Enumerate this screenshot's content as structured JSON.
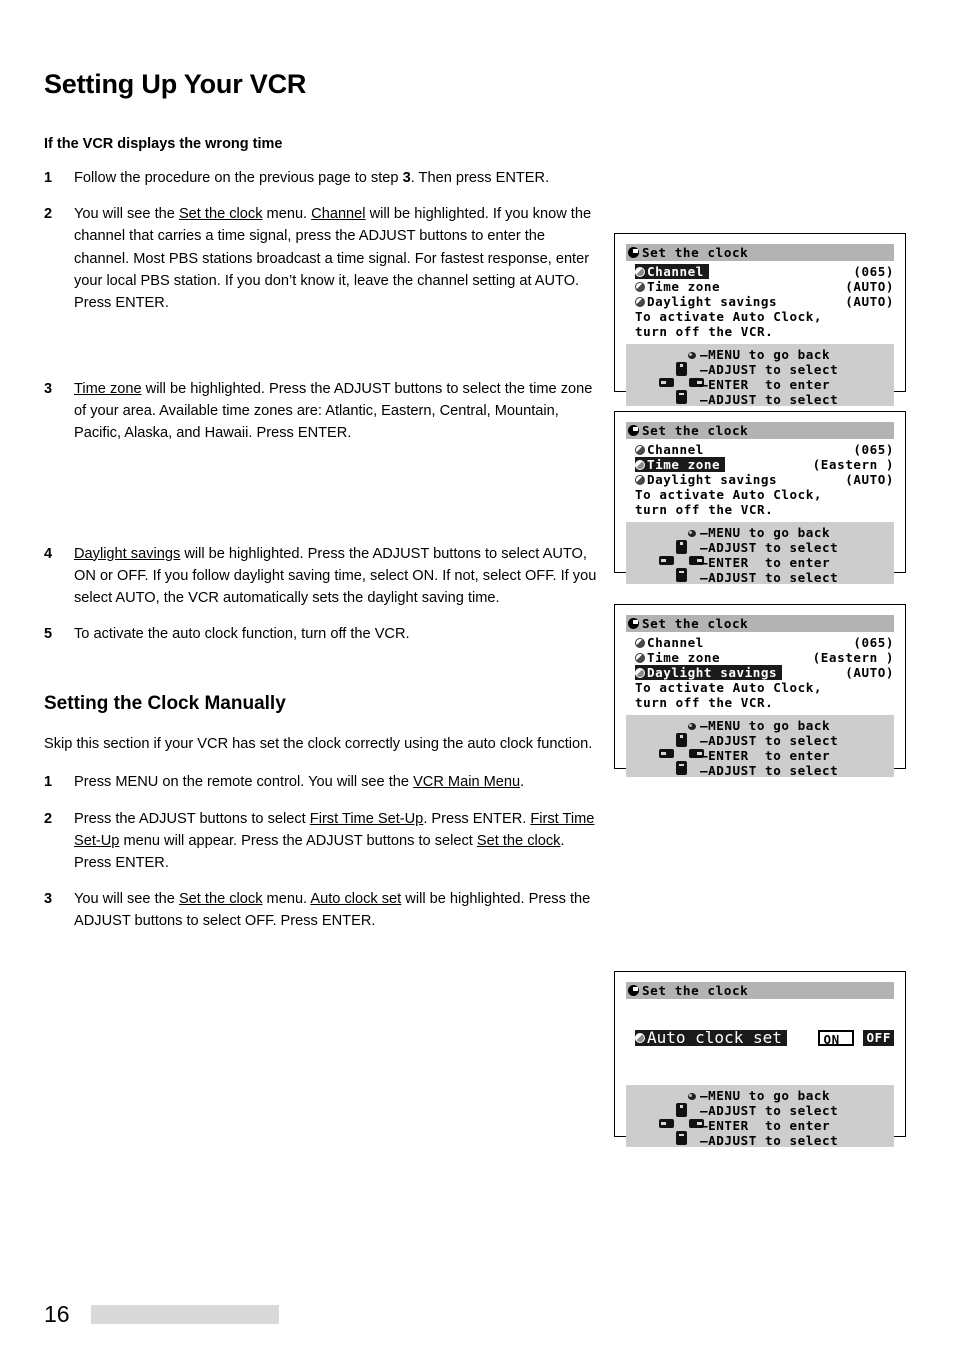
{
  "document": {
    "title": "Setting Up Your VCR",
    "folio": "16"
  },
  "section_wrong_time": {
    "heading": "If the VCR displays the wrong time",
    "steps": [
      {
        "num": "1",
        "parts": [
          {
            "t": "Follow the procedure on the previous page to step ",
            "style": "plain"
          },
          {
            "t": "3",
            "style": "bold"
          },
          {
            "t": ".  Then press ENTER.",
            "style": "plain"
          }
        ]
      },
      {
        "num": "2",
        "parts": [
          {
            "t": "You will see the ",
            "style": "plain"
          },
          {
            "t": "Set the clock",
            "style": "underline"
          },
          {
            "t": " menu.  ",
            "style": "plain"
          },
          {
            "t": "Channel",
            "style": "underline"
          },
          {
            "t": " will be highlighted.  If you know the channel that carries a time signal, press the ADJUST buttons to enter the channel.  Most PBS stations broadcast a time signal.  For fastest response, enter your local PBS station.  If you don’t know it, leave the channel setting at AUTO.  Press ENTER.",
            "style": "plain"
          }
        ]
      },
      {
        "num": "3",
        "parts": [
          {
            "t": "Time zone",
            "style": "underline"
          },
          {
            "t": " will be highlighted.  Press the ADJUST buttons to select the time zone of your area.  Available time zones are: Atlantic, Eastern, Central, Mountain, Pacific, Alaska, and Hawaii.  Press ENTER.",
            "style": "plain"
          }
        ]
      },
      {
        "num": "4",
        "parts": [
          {
            "t": "Daylight savings",
            "style": "underline"
          },
          {
            "t": " will be highlighted.  Press the ADJUST buttons to select AUTO, ON or OFF.  If you follow daylight saving time, select ON.  If not, select OFF.  If you select AUTO, the VCR automatically sets the daylight saving time.",
            "style": "plain"
          }
        ]
      },
      {
        "num": "5",
        "parts": [
          {
            "t": "To activate the auto clock function, turn off the VCR.",
            "style": "plain"
          }
        ]
      }
    ]
  },
  "section_manual": {
    "heading": "Setting the Clock Manually",
    "intro": "Skip this section if your VCR has set the clock correctly using the auto clock function.",
    "steps": [
      {
        "num": "1",
        "parts": [
          {
            "t": "Press MENU on the remote control.  You will see the ",
            "style": "plain"
          },
          {
            "t": "VCR Main Menu",
            "style": "underline"
          },
          {
            "t": ".",
            "style": "plain"
          }
        ]
      },
      {
        "num": "2",
        "parts": [
          {
            "t": "Press the ADJUST buttons to select ",
            "style": "plain"
          },
          {
            "t": "First Time Set-Up",
            "style": "underline"
          },
          {
            "t": ".  Press ENTER.  ",
            "style": "plain"
          },
          {
            "t": "First Time Set-Up",
            "style": "underline"
          },
          {
            "t": " menu will appear.  Press the ADJUST buttons to select ",
            "style": "plain"
          },
          {
            "t": "Set the clock",
            "style": "underline"
          },
          {
            "t": ".  Press ENTER.",
            "style": "plain"
          }
        ]
      },
      {
        "num": "3",
        "parts": [
          {
            "t": "You will see the ",
            "style": "plain"
          },
          {
            "t": "Set the clock",
            "style": "underline"
          },
          {
            "t": " menu.  ",
            "style": "plain"
          },
          {
            "t": "Auto clock set",
            "style": "underline"
          },
          {
            "t": " will be highlighted.  Press the ADJUST buttons to select OFF.  Press ENTER.",
            "style": "plain"
          }
        ]
      }
    ]
  },
  "osd_legend": {
    "menu": "—MENU to go back",
    "adjust_up": "—ADJUST to select",
    "enter": "—ENTER  to enter",
    "adjust_down": "—ADJUST to select"
  },
  "osd_screens": [
    {
      "id": "set-the-clock-channel",
      "title": "Set the clock",
      "rows": [
        {
          "label": "Channel",
          "value": "(065)",
          "highlighted": true
        },
        {
          "label": "Time zone",
          "value": "(AUTO)",
          "highlighted": false
        },
        {
          "label": "Daylight savings",
          "value": "(AUTO)",
          "highlighted": false
        }
      ],
      "note_line1": "To activate Auto Clock,",
      "note_line2": "turn off the VCR."
    },
    {
      "id": "set-the-clock-timezone",
      "title": "Set the clock",
      "rows": [
        {
          "label": "Channel",
          "value": "(065)",
          "highlighted": false
        },
        {
          "label": "Time zone",
          "value": "(Eastern )",
          "highlighted": true
        },
        {
          "label": "Daylight savings",
          "value": "(AUTO)",
          "highlighted": false
        }
      ],
      "note_line1": "To activate Auto Clock,",
      "note_line2": "turn off the VCR."
    },
    {
      "id": "set-the-clock-daylight",
      "title": "Set the clock",
      "rows": [
        {
          "label": "Channel",
          "value": "(065)",
          "highlighted": false
        },
        {
          "label": "Time zone",
          "value": "(Eastern )",
          "highlighted": false
        },
        {
          "label": "Daylight savings",
          "value": "(AUTO)",
          "highlighted": true
        }
      ],
      "note_line1": "To activate Auto Clock,",
      "note_line2": "turn off the VCR."
    }
  ],
  "osd_autoclock": {
    "id": "set-the-clock-autoclockset",
    "title": "Set the clock",
    "row_label": "Auto clock set",
    "toggle_on": "ON",
    "toggle_off": "OFF"
  },
  "colors": {
    "titlebar_gray": "#b3b3b3",
    "legend_gray": "#cdcdcd",
    "highlight_black": "#1a1a1a",
    "folio_bar_gray": "#d9d9d9"
  }
}
